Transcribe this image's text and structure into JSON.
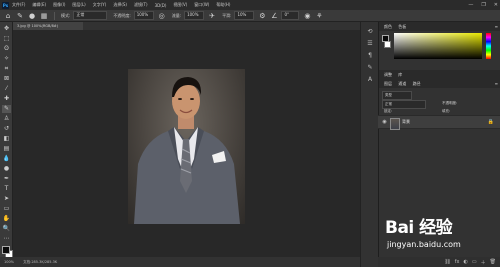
{
  "app": {
    "logo": "Ps",
    "menu": [
      "文件(F)",
      "编辑(E)",
      "图像(I)",
      "图层(L)",
      "文字(Y)",
      "选择(S)",
      "滤镜(T)",
      "3D(D)",
      "视图(V)",
      "窗口(W)",
      "帮助(H)"
    ],
    "window_controls": [
      "—",
      "❐",
      "✕"
    ]
  },
  "options_bar": {
    "mode_label": "模式:",
    "mode_value": "正常",
    "opacity_label": "不透明度:",
    "opacity_value": "100%",
    "flow_label": "流量:",
    "flow_value": "100%",
    "smoothing_label": "平滑:",
    "smoothing_value": "10%",
    "angle_value": "0°"
  },
  "document": {
    "tab_title": "3.jpg @ 100%(RGB/8#)",
    "status_zoom": "100%",
    "status_doc": "文档:285.3K/285.3K"
  },
  "panels": {
    "color_tabs": [
      "颜色",
      "色板"
    ],
    "adjust_tabs": [
      "调整",
      "库"
    ],
    "layers_tabs": [
      "图层",
      "通道",
      "路径"
    ],
    "kind_label": "类型",
    "blend_mode": "正常",
    "opacity_label": "不透明度:",
    "lock_label": "锁定:",
    "fill_label": "填充:",
    "layer_name": "背景"
  },
  "colors": {
    "foreground": "#0a0a0a",
    "background": "#ffffff"
  },
  "watermark": {
    "main": "Bai 经验",
    "sub": "jingyan.baidu.com"
  }
}
